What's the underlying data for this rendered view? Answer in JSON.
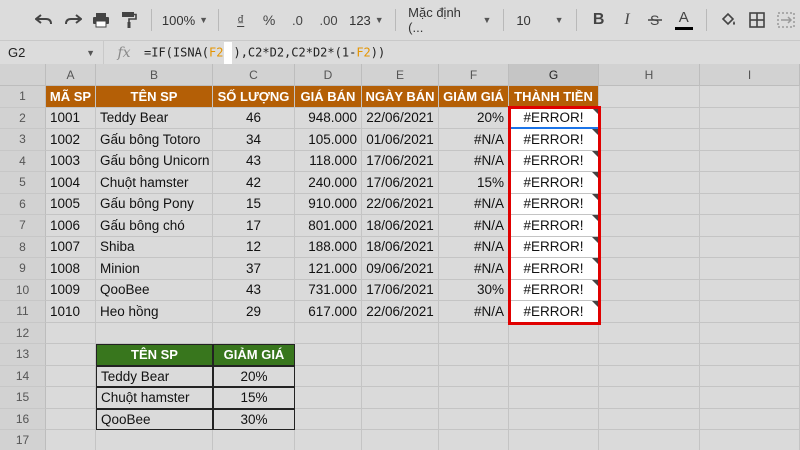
{
  "toolbar": {
    "zoom": "100%",
    "currency": "₫",
    "percent": "%",
    "dec_less": ".0",
    "dec_more": ".00",
    "number_format": "123",
    "font": "Mặc định (...",
    "font_size": "10",
    "bold": "B",
    "italic": "I",
    "text_color_letter": "A"
  },
  "formula_bar": {
    "name_box": "G2",
    "fx": "fx",
    "f1": "=IF(ISNA(",
    "f2": "F2",
    "f3": "),C2*D2,C2*D2*(1-",
    "f4": "F2",
    "f5": "))"
  },
  "columns": [
    "A",
    "B",
    "C",
    "D",
    "E",
    "F",
    "G",
    "H",
    "I"
  ],
  "rows": [
    "1",
    "2",
    "3",
    "4",
    "5",
    "6",
    "7",
    "8",
    "9",
    "10",
    "11",
    "12",
    "13",
    "14",
    "15",
    "16",
    "17"
  ],
  "table_headers": [
    "MÃ SP",
    "TÊN SP",
    "SỐ LƯỢNG",
    "GIÁ BÁN",
    "NGÀY BÁN",
    "GIẢM GIÁ",
    "THÀNH TIỀN"
  ],
  "table_rows": [
    [
      "1001",
      "Teddy Bear",
      "46",
      "948.000",
      "22/06/2021",
      "20%",
      "#ERROR!"
    ],
    [
      "1002",
      "Gấu bông Totoro",
      "34",
      "105.000",
      "01/06/2021",
      "#N/A",
      "#ERROR!"
    ],
    [
      "1003",
      "Gấu bông Unicorn",
      "43",
      "118.000",
      "17/06/2021",
      "#N/A",
      "#ERROR!"
    ],
    [
      "1004",
      "Chuột hamster",
      "42",
      "240.000",
      "17/06/2021",
      "15%",
      "#ERROR!"
    ],
    [
      "1005",
      "Gấu bông Pony",
      "15",
      "910.000",
      "22/06/2021",
      "#N/A",
      "#ERROR!"
    ],
    [
      "1006",
      "Gấu bông chó",
      "17",
      "801.000",
      "18/06/2021",
      "#N/A",
      "#ERROR!"
    ],
    [
      "1007",
      "Shiba",
      "12",
      "188.000",
      "18/06/2021",
      "#N/A",
      "#ERROR!"
    ],
    [
      "1008",
      "Minion",
      "37",
      "121.000",
      "09/06/2021",
      "#N/A",
      "#ERROR!"
    ],
    [
      "1009",
      "QooBee",
      "43",
      "731.000",
      "17/06/2021",
      "30%",
      "#ERROR!"
    ],
    [
      "1010",
      "Heo hồng",
      "29",
      "617.000",
      "22/06/2021",
      "#N/A",
      "#ERROR!"
    ]
  ],
  "lookup_headers": [
    "TÊN SP",
    "GIẢM GIÁ"
  ],
  "lookup_rows": [
    [
      "Teddy Bear",
      "20%"
    ],
    [
      "Chuột hamster",
      "15%"
    ],
    [
      "QooBee",
      "30%"
    ]
  ],
  "colors": {
    "header_bg": "#b45f06",
    "lookup_header_bg": "#38761d",
    "highlight": "#e00000"
  }
}
